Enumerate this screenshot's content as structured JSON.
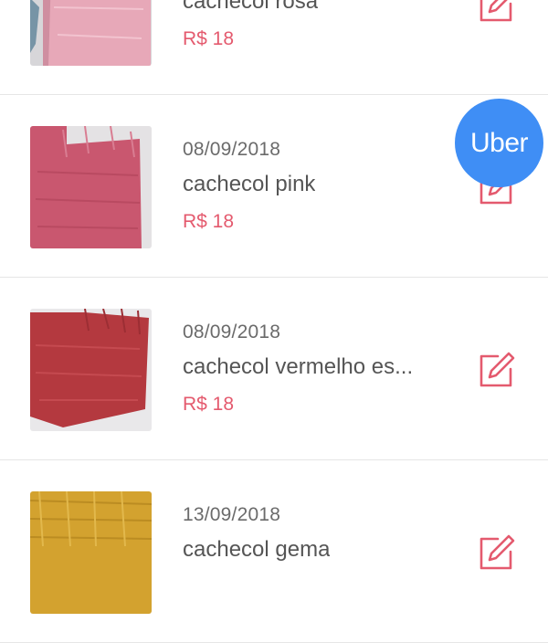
{
  "items": [
    {
      "date": "",
      "title": "cachecol rosa",
      "price": "R$ 18",
      "image": "pink-knit-scarf"
    },
    {
      "date": "08/09/2018",
      "title": "cachecol pink",
      "price": "R$ 18",
      "image": "magenta-knit-scarf"
    },
    {
      "date": "08/09/2018",
      "title": "cachecol vermelho es...",
      "price": "R$ 18",
      "image": "red-knit-scarf"
    },
    {
      "date": "13/09/2018",
      "title": "cachecol gema",
      "price": "",
      "image": "yellow-knit-scarf"
    }
  ],
  "edit_icon": "edit-pencil-icon",
  "overlay": {
    "label": "Uber",
    "color": "#3f8ef5"
  },
  "colors": {
    "price": "#e45a6e",
    "icon": "#e45a6e"
  }
}
